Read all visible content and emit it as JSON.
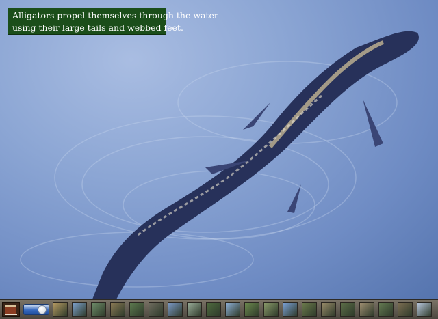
{
  "slide": {
    "caption_lines": [
      "Alligators propel themselves through the water",
      "using their large tails and webbed feet."
    ],
    "subject": "alligator swimming in water"
  },
  "filmstrip": {
    "home_icon": "treasure-chest-icon",
    "slider": {
      "position_fraction": 0.85
    },
    "thumbnail_colors": [
      "#b59a62",
      "#7fa3cf",
      "#6f8d6a",
      "#8b7a55",
      "#5d7a4f",
      "#6e6b5e",
      "#7b99c6",
      "#9bae9a",
      "#4f6b3f",
      "#8fb0d8",
      "#6c8a4e",
      "#8a9a6a",
      "#7aa0d5",
      "#6b7a4c",
      "#9a8c6a",
      "#5c6e48",
      "#a08f72",
      "#647a52",
      "#7c6d52",
      "#b7c6dc"
    ]
  }
}
